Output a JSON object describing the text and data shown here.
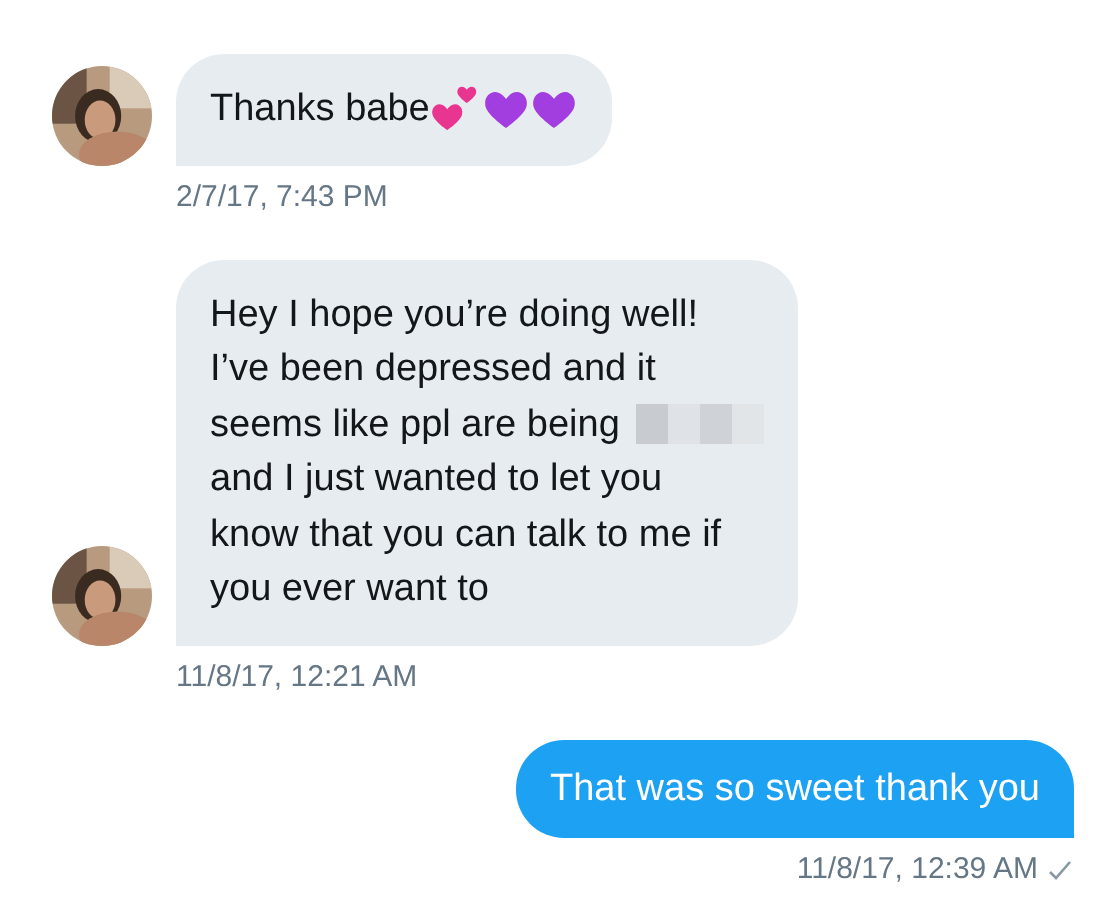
{
  "messages": [
    {
      "kind": "incoming",
      "lines": [
        {
          "text": "Thanks babe",
          "redacted": false
        }
      ],
      "emoji": [
        {
          "kind": "two_hearts",
          "color": "#e8358f"
        },
        {
          "kind": "heart",
          "color": "#a23ee0"
        },
        {
          "kind": "heart",
          "color": "#a23ee0"
        }
      ],
      "timestamp": "2/7/17, 7:43 PM"
    },
    {
      "kind": "incoming",
      "lines": [
        {
          "text": "Hey I hope you’re doing well!",
          "redacted": false
        },
        {
          "text": "I’ve been depressed and it",
          "redacted": false
        },
        {
          "text": "seems like ppl are being",
          "redacted": true
        },
        {
          "text": "and I just wanted to let you",
          "redacted": false
        },
        {
          "text": "know that you can talk to me if",
          "redacted": false
        },
        {
          "text": "you ever want to",
          "redacted": false
        }
      ],
      "timestamp": "11/8/17, 12:21 AM"
    },
    {
      "kind": "outgoing",
      "lines": [
        {
          "text": "That was so sweet thank you",
          "redacted": false
        }
      ],
      "timestamp": "11/8/17, 12:39 AM",
      "delivered": true
    }
  ]
}
